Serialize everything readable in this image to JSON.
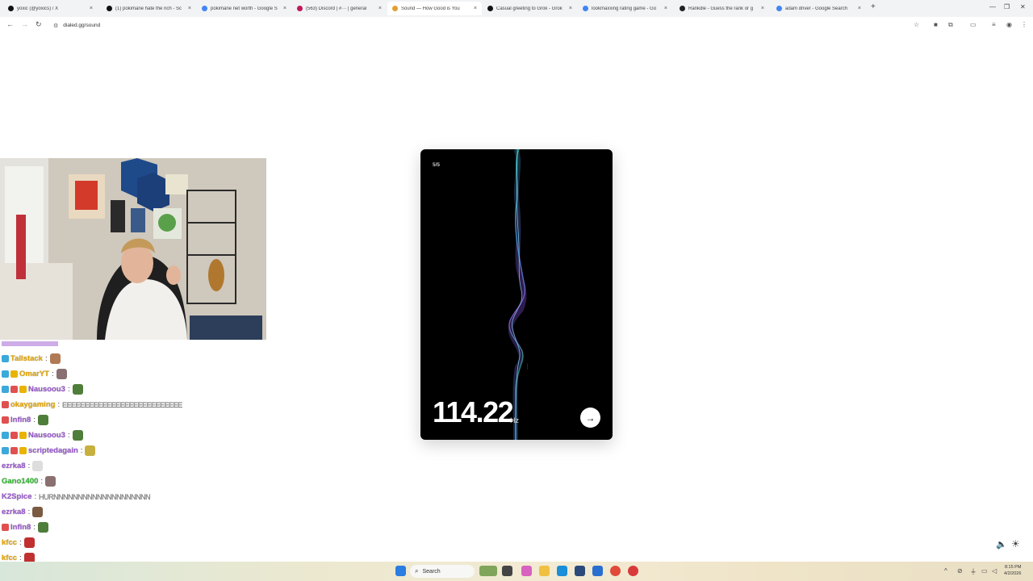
{
  "browser": {
    "tabs": [
      {
        "title": "yoxic (@yoxics) / X",
        "active": false,
        "favicon_color": "#111111"
      },
      {
        "title": "(1) pokimane hate the rich - Sc",
        "active": false,
        "favicon_color": "#111111"
      },
      {
        "title": "pokimane net worth - Google S",
        "active": false,
        "favicon_color": "#4285f4"
      },
      {
        "title": "(563) Discord | #··· | general",
        "active": false,
        "favicon_color": "#c2185b"
      },
      {
        "title": "Sound — How Good is You",
        "active": true,
        "favicon_color": "#e0a030"
      },
      {
        "title": "Casual greeting to Grok - Grok",
        "active": false,
        "favicon_color": "#111111"
      },
      {
        "title": "lookmaxxing rating game - Go",
        "active": false,
        "favicon_color": "#4285f4"
      },
      {
        "title": "Rankdle - Guess the rank or g",
        "active": false,
        "favicon_color": "#222222"
      },
      {
        "title": "adam driver - Google Search",
        "active": false,
        "favicon_color": "#4285f4"
      }
    ],
    "close_glyph": "×",
    "new_tab_glyph": "+",
    "url": "dialed.gg/sound"
  },
  "game": {
    "counter": "5/5",
    "frequency": "114.22",
    "unit": "Hz",
    "next_glyph": "→"
  },
  "chat": {
    "messages": [
      {
        "user": "Tallstack",
        "color": "#e8a800",
        "badges": [
          "#3ba9d9"
        ],
        "emote": "#b07a55",
        "text": ""
      },
      {
        "user": "OmarYT",
        "color": "#e8a800",
        "badges": [
          "#3ba9d9",
          "#e8b400"
        ],
        "emote": "#8a7070",
        "text": ""
      },
      {
        "user": "Nausoou3",
        "color": "#9b59d0",
        "badges": [
          "#3ba9d9",
          "#e05050",
          "#e8b400"
        ],
        "emote": "#4f7d3a",
        "text": ""
      },
      {
        "user": "okaygaming",
        "color": "#e8a800",
        "badges": [
          "#e05050"
        ],
        "emote": "",
        "text": "EEEEEEEEEEEEEEEEEEEEEEEEEEE"
      },
      {
        "user": "Infin8",
        "color": "#9b59d0",
        "badges": [
          "#e05050"
        ],
        "emote": "#4f7d3a",
        "text": ""
      },
      {
        "user": "Nausoou3",
        "color": "#9b59d0",
        "badges": [
          "#3ba9d9",
          "#e05050",
          "#e8b400"
        ],
        "emote": "#4f7d3a",
        "text": ""
      },
      {
        "user": "scriptedagain",
        "color": "#9b59d0",
        "badges": [
          "#3ba9d9",
          "#e05050",
          "#e8b400"
        ],
        "emote": "#c8b040",
        "text": ""
      },
      {
        "user": "ezrka8",
        "color": "#9b59d0",
        "badges": [],
        "emote": "#dddddd",
        "text": ""
      },
      {
        "user": "Gano1400",
        "color": "#2eb82e",
        "badges": [],
        "emote": "#8a7070",
        "text": ""
      },
      {
        "user": "K2Spice",
        "color": "#9b59d0",
        "badges": [],
        "emote": "",
        "text": "HURNNNNNNNNNNNNNNNNNNNN"
      },
      {
        "user": "ezrka8",
        "color": "#9b59d0",
        "badges": [],
        "emote": "#7a5a40",
        "text": ""
      },
      {
        "user": "Infin8",
        "color": "#9b59d0",
        "badges": [
          "#e05050"
        ],
        "emote": "#4f7d3a",
        "text": ""
      },
      {
        "user": "kfcc",
        "color": "#e8a800",
        "badges": [],
        "emote": "#c03030",
        "text": ""
      },
      {
        "user": "kfcc",
        "color": "#e8a800",
        "badges": [],
        "emote": "#c03030",
        "text": ""
      }
    ]
  },
  "taskbar": {
    "search_label": "Search",
    "time": "8:15 PM",
    "date": "4/2/2026"
  }
}
